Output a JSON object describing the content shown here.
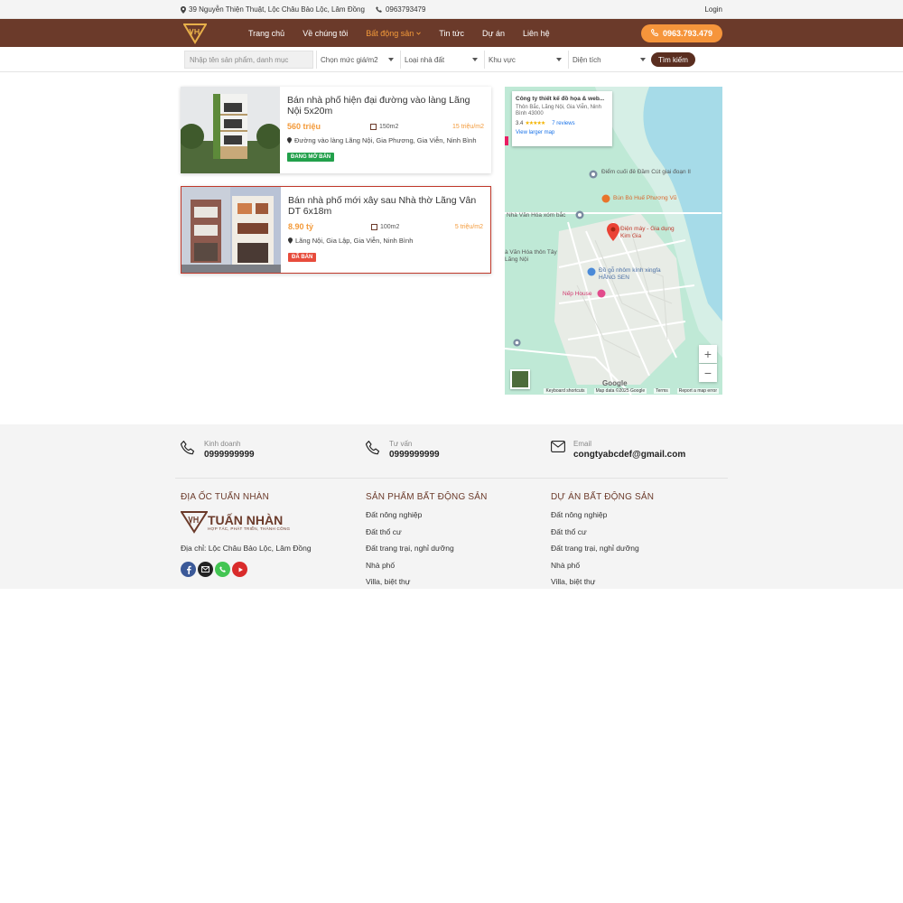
{
  "topbar": {
    "address": "39 Nguyễn Thiện Thuật, Lộc Châu Bảo Lộc, Lâm Đồng",
    "phone": "0963793479",
    "login": "Login"
  },
  "nav": {
    "items": [
      "Trang chủ",
      "Về chúng tôi",
      "Bất động sản",
      "Tin tức",
      "Dự án",
      "Liên hệ"
    ],
    "active_index": 2,
    "phone_button": "0963.793.479"
  },
  "search": {
    "placeholder": "Nhập tên sản phẩm, danh mục",
    "price": "Chọn mức giá/m2",
    "type": "Loại nhà đất",
    "region": "Khu vực",
    "area": "Diện tích",
    "button": "Tìm kiếm"
  },
  "listings": [
    {
      "title": "Bán nhà phố hiện đại đường vào làng Lãng Nội 5x20m",
      "price": "560 triệu",
      "area": "150m2",
      "price_per_m2": "15 triệu/m2",
      "address": "Đường vào làng Lãng Nội, Gia Phương, Gia Viễn, Ninh Bình",
      "status": "ĐANG MỞ BÁN",
      "status_color": "#22a04b"
    },
    {
      "title": "Bán nhà phố mới xây sau Nhà thờ Lãng Vân DT 6x18m",
      "price": "8.90 tỷ",
      "area": "100m2",
      "price_per_m2": "5 triệu/m2",
      "address": "Lãng Nội, Gia Lập, Gia Viễn, Ninh Bình",
      "status": "ĐÃ BÁN",
      "status_color": "#e74c3c"
    }
  ],
  "map": {
    "info_title": "Công ty thiết kế đồ họa & web...",
    "info_address": "Thôn Bắc, Lãng Nội, Gia Viễn, Ninh Bình 43000",
    "rating": "3.4",
    "reviews": "7 reviews",
    "larger_map": "View larger map",
    "labels": {
      "l1": "Điểm cuối đê Đầm Cút giai đoạn II",
      "l2": "Bún Bò Huế Phương Vũ",
      "l3": "Nhà Văn Hóa xóm bắc",
      "l4": "Điện máy - Gia dụng Kim Gia",
      "l5": "à Văn Hóa thôn Tây Lãng Nội",
      "l6": "Đồ gỗ nhôm kính xingfa HẰNG SEN",
      "l7": "Nếp House"
    },
    "zoom_in": "+",
    "zoom_out": "−",
    "google": "Google",
    "footer": [
      "Keyboard shortcuts",
      "Map data ©2025 Google",
      "Terms",
      "Report a map error"
    ]
  },
  "footer": {
    "contacts": [
      {
        "label": "Kinh doanh",
        "value": "0999999999"
      },
      {
        "label": "Tư vấn",
        "value": "0999999999"
      },
      {
        "label": "Email",
        "value": "congtyabcdef@gmail.com"
      }
    ],
    "col1_heading": "ĐỊA ỐC TUẤN NHÀN",
    "brand_name": "TUẤN NHÀN",
    "brand_tagline": "HỢP TÁC, PHÁT TRIỂN, THÀNH CÔNG",
    "address": "Địa chỉ: Lộc Châu Bảo Lộc, Lâm Đồng",
    "col2_heading": "SẢN PHẨM BẤT ĐỘNG SẢN",
    "col2_links": [
      "Đất nông nghiệp",
      "Đất thổ cư",
      "Đất trang trại, nghỉ dưỡng",
      "Nhà phố",
      "Villa, biệt thự"
    ],
    "col3_heading": "DỰ ÁN BẤT ĐỘNG SẢN",
    "col3_links": [
      "Đất nông nghiệp",
      "Đất thổ cư",
      "Đất trang trại, nghỉ dưỡng",
      "Nhà phố",
      "Villa, biệt thự"
    ]
  },
  "colors": {
    "brand": "#6b3a2a",
    "accent": "#f6953b"
  }
}
